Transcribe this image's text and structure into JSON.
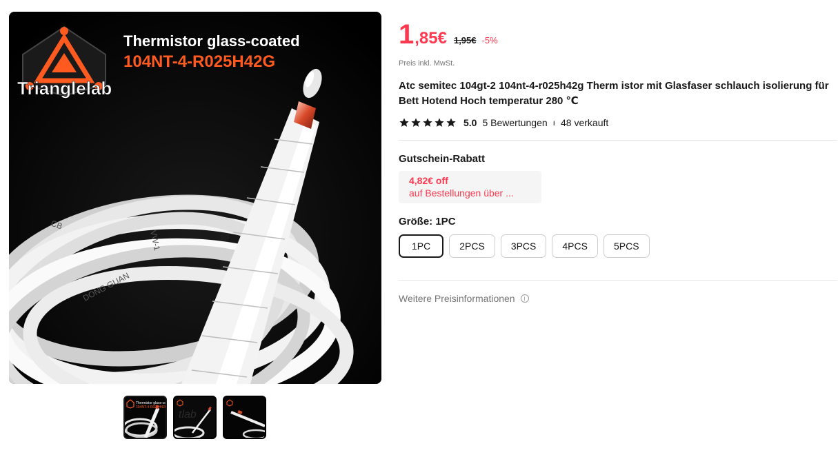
{
  "gallery": {
    "main_image": {
      "brand": "Trianglelab",
      "headline": "Thermistor glass-coated",
      "model": "104NT-4-R025H42G",
      "watermark": "lab",
      "icon": "product-photo"
    },
    "thumbnails": [
      {
        "icon": "thumbnail-coil"
      },
      {
        "icon": "thumbnail-probe"
      },
      {
        "icon": "thumbnail-wire"
      }
    ],
    "active_thumbnail": 0
  },
  "price": {
    "current_whole": "1",
    "current_rest": ",85€",
    "original": "1,95€",
    "discount": "-5%",
    "tax_note": "Preis inkl. MwSt."
  },
  "product": {
    "title": "Atc semitec 104gt-2 104nt-4-r025h42g Therm istor mit Glasfaser schlauch isolierung für Bett Hotend Hoch temperatur 280 ℃"
  },
  "rating": {
    "stars": 5,
    "score": "5.0",
    "reviews": "5 Bewertungen",
    "separator": "ı",
    "sold": "48 verkauft",
    "star_color": "#191919"
  },
  "coupon": {
    "heading": "Gutschein-Rabatt",
    "value": "4,82€ off",
    "condition": "auf Bestellungen über ..."
  },
  "size": {
    "label": "Größe:",
    "selected": "1PC",
    "options": [
      "1PC",
      "2PCS",
      "3PCS",
      "4PCS",
      "5PCS"
    ]
  },
  "more_info": {
    "label": "Weitere Preisinformationen",
    "icon": "info-icon"
  },
  "colors": {
    "accent": "#fd384f",
    "text": "#191919",
    "muted": "#757575",
    "brand_orange": "#ff5a1f"
  }
}
